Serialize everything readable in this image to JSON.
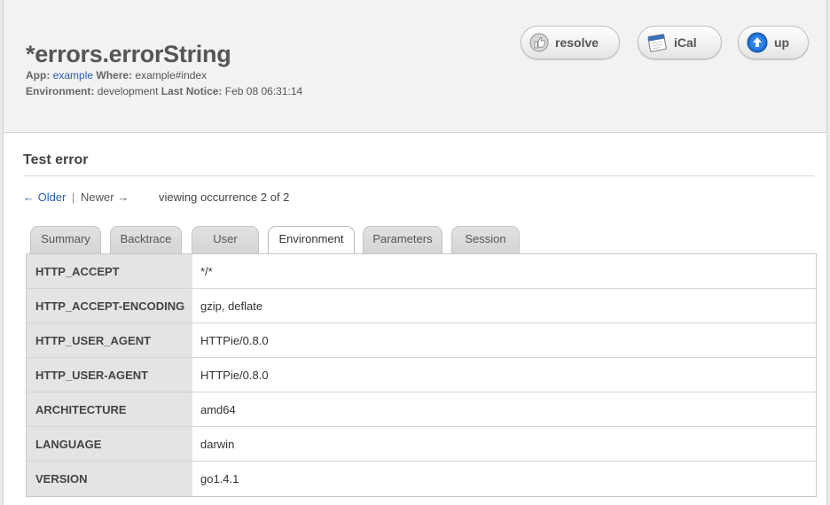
{
  "error": {
    "title": "*errors.errorString",
    "app_label": "App:",
    "app_value": "example",
    "where_label": "Where:",
    "where_value": "example#index",
    "environment_label": "Environment:",
    "environment_value": "development",
    "last_notice_label": "Last Notice:",
    "last_notice_value": "Feb 08 06:31:14"
  },
  "actions": {
    "resolve": "resolve",
    "ical": "iCal",
    "up": "up"
  },
  "section": {
    "title": "Test error"
  },
  "navigation": {
    "older": "← Older",
    "separator": "|",
    "newer": "Newer →",
    "occurrence": "viewing occurrence 2 of 2"
  },
  "tabs": [
    {
      "label": "Summary",
      "active": false
    },
    {
      "label": "Backtrace",
      "active": false
    },
    {
      "label": "User",
      "active": false
    },
    {
      "label": "Environment",
      "active": true
    },
    {
      "label": "Parameters",
      "active": false
    },
    {
      "label": "Session",
      "active": false
    }
  ],
  "environment_rows": [
    {
      "key": "HTTP_ACCEPT",
      "value": "*/*"
    },
    {
      "key": "HTTP_ACCEPT-ENCODING",
      "value": "gzip, deflate"
    },
    {
      "key": "HTTP_USER_AGENT",
      "value": "HTTPie/0.8.0"
    },
    {
      "key": "HTTP_USER-AGENT",
      "value": "HTTPie/0.8.0"
    },
    {
      "key": "ARCHITECTURE",
      "value": "amd64"
    },
    {
      "key": "LANGUAGE",
      "value": "darwin"
    },
    {
      "key": "VERSION",
      "value": "go1.4.1"
    }
  ],
  "colors": {
    "link": "#2a5db0",
    "header_bg": "#f2f2f2",
    "up_icon": "#1f6fd1"
  },
  "icons": {
    "resolve": "thumbs-up-icon",
    "ical": "calendar-icon",
    "up": "arrow-up-circle-icon"
  }
}
